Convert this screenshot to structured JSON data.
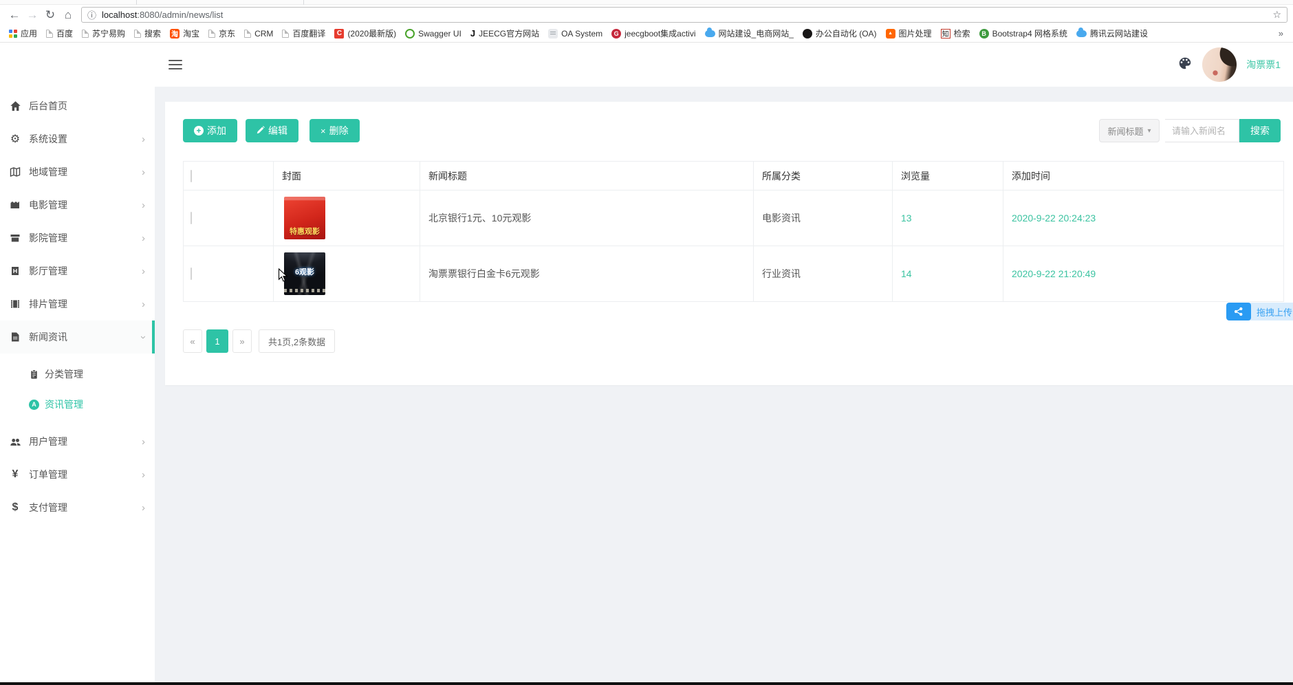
{
  "browser": {
    "nav": {
      "back": "←",
      "forward": "→",
      "reload": "↻",
      "home": "⌂"
    },
    "address": {
      "info": "ⓘ",
      "host": "localhost",
      "path": ":8080/admin/news/list",
      "star": "☆"
    }
  },
  "bookmarks": {
    "overflow": "»",
    "items": [
      {
        "label": "应用",
        "icon": "apps-grid"
      },
      {
        "label": "百度",
        "icon": "page"
      },
      {
        "label": "苏宁易购",
        "icon": "page"
      },
      {
        "label": "搜索",
        "icon": "page"
      },
      {
        "label": "淘宝",
        "icon": "taobao",
        "glyph": "淘"
      },
      {
        "label": "京东",
        "icon": "page"
      },
      {
        "label": "CRM",
        "icon": "page"
      },
      {
        "label": "百度翻译",
        "icon": "page"
      },
      {
        "label": "(2020最新版)",
        "icon": "c-red",
        "glyph": "C"
      },
      {
        "label": "Swagger UI",
        "icon": "swagger"
      },
      {
        "label": "JEECG官方网站",
        "icon": "jeecg",
        "glyph": "J"
      },
      {
        "label": "OA System",
        "icon": "oa"
      },
      {
        "label": "jeecgboot集成activi",
        "icon": "g-red",
        "glyph": "G"
      },
      {
        "label": "网站建设_电商网站_",
        "icon": "cloud"
      },
      {
        "label": "办公自动化 (OA)",
        "icon": "github"
      },
      {
        "label": "图片处理",
        "icon": "image",
        "glyph": "▲"
      },
      {
        "label": "检索",
        "icon": "zhihu",
        "glyph": "知"
      },
      {
        "label": "Bootstrap4 网格系统",
        "icon": "bootstrap",
        "glyph": "B"
      },
      {
        "label": "腾讯云网站建设",
        "icon": "cloud"
      }
    ]
  },
  "sidebar": {
    "chevron": "›",
    "items": [
      {
        "label": "后台首页"
      },
      {
        "label": "系统设置"
      },
      {
        "label": "地域管理"
      },
      {
        "label": "电影管理"
      },
      {
        "label": "影院管理"
      },
      {
        "label": "影厅管理"
      },
      {
        "label": "排片管理"
      },
      {
        "label": "新闻资讯"
      },
      {
        "label": "分类管理"
      },
      {
        "label": "资讯管理"
      },
      {
        "label": "用户管理"
      },
      {
        "label": "订单管理",
        "glyph": "¥"
      },
      {
        "label": "支付管理",
        "glyph": "$"
      }
    ],
    "icons": {
      "gear": "⚙",
      "circle_a": "A"
    }
  },
  "header": {
    "username": "淘票票1"
  },
  "toolbar": {
    "add": "添加",
    "edit": "编辑",
    "del": "删除",
    "plus": "+",
    "x": "×"
  },
  "search": {
    "filter": "新闻标题",
    "caret": "▾",
    "placeholder": "请输入新闻名",
    "button": "搜索"
  },
  "table": {
    "columns": [
      "封面",
      "新闻标题",
      "所属分类",
      "浏览量",
      "添加时间"
    ],
    "rows": [
      {
        "cover_text": "特惠观影",
        "title": "北京银行1元、10元观影",
        "category": "电影资讯",
        "views": "13",
        "time": "2020-9-22 20:24:23"
      },
      {
        "cover_text": "6观影",
        "title": "淘票票银行白金卡6元观影",
        "category": "行业资讯",
        "views": "14",
        "time": "2020-9-22 21:20:49"
      }
    ]
  },
  "pagination": {
    "prev": "«",
    "page": "1",
    "next": "»",
    "summary": "共1页,2条数据"
  },
  "upload": {
    "label": "拖拽上传"
  },
  "colors": {
    "accent": "#2ec3a6",
    "teal_text": "#3bc3a1",
    "upload_blue": "#2a9bf3"
  }
}
